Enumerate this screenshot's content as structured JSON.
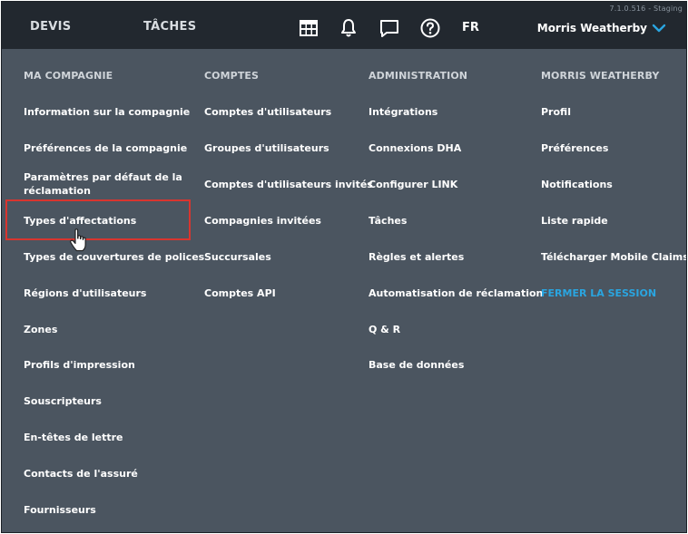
{
  "header": {
    "version": "7.1.0.516 - Staging",
    "tabs": [
      {
        "label": "DEVIS"
      },
      {
        "label": "TÂCHES"
      }
    ],
    "icons": [
      "dashboard-icon",
      "bell-icon",
      "chat-icon",
      "help-icon"
    ],
    "language": "FR",
    "user_name": "Morris Weatherby"
  },
  "colors": {
    "topbar": "#22282f",
    "menu_bg": "#4b5560",
    "logout": "#2aa5e0",
    "highlight": "#d9352f"
  },
  "menu": {
    "columns": [
      {
        "header": "MA COMPAGNIE",
        "items": [
          {
            "label": "Information sur la compagnie"
          },
          {
            "label": "Préférences de la compagnie"
          },
          {
            "label": "Paramètres par défaut de la\nréclamation"
          },
          {
            "label": "Types d'affectations"
          },
          {
            "label": "Types de couvertures de polices"
          },
          {
            "label": "Régions d'utilisateurs"
          },
          {
            "label": "Zones"
          },
          {
            "label": "Profils d'impression"
          },
          {
            "label": "Souscripteurs"
          },
          {
            "label": "En-têtes de lettre"
          },
          {
            "label": "Contacts de l'assuré"
          },
          {
            "label": "Fournisseurs"
          }
        ]
      },
      {
        "header": "COMPTES",
        "items": [
          {
            "label": "Comptes d'utilisateurs"
          },
          {
            "label": "Groupes d'utilisateurs"
          },
          {
            "label": "Comptes d'utilisateurs invités"
          },
          {
            "label": "Compagnies invitées"
          },
          {
            "label": "Succursales"
          },
          {
            "label": "Comptes API"
          }
        ]
      },
      {
        "header": "ADMINISTRATION",
        "items": [
          {
            "label": "Intégrations"
          },
          {
            "label": "Connexions DHA"
          },
          {
            "label": "Configurer LINK"
          },
          {
            "label": "Tâches"
          },
          {
            "label": "Règles et alertes"
          },
          {
            "label": "Automatisation de réclamation"
          },
          {
            "label": "Q & R"
          },
          {
            "label": "Base de données"
          }
        ]
      },
      {
        "header": "MORRIS WEATHERBY",
        "items": [
          {
            "label": "Profil"
          },
          {
            "label": "Préférences"
          },
          {
            "label": "Notifications"
          },
          {
            "label": "Liste rapide"
          },
          {
            "label": "Télécharger Mobile Claims"
          },
          {
            "label": "FERMER LA SESSION"
          }
        ]
      }
    ]
  }
}
